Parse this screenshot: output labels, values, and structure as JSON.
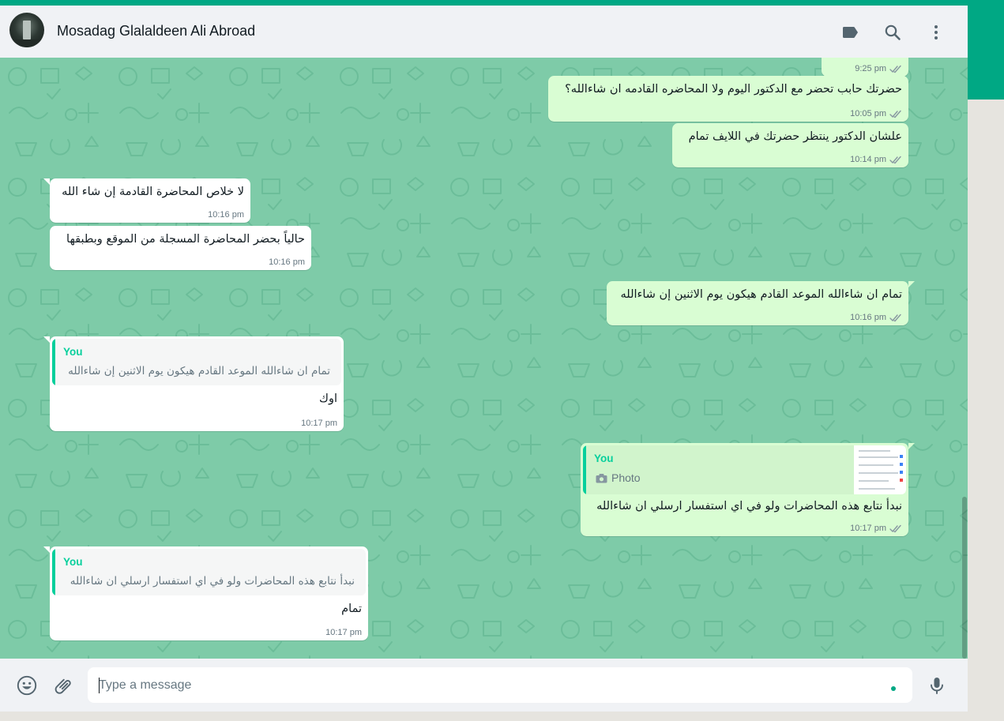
{
  "contact": {
    "name": "Mosadag Glalaldeen Ali Abroad"
  },
  "header_icons": [
    "label-icon",
    "search-icon",
    "menu-icon"
  ],
  "messages": [
    {
      "dir": "out",
      "text": "",
      "time": "9:25 pm"
    },
    {
      "dir": "out",
      "text": "حضرتك حابب تحضر مع الدكتور اليوم ولا المحاضره القادمه ان شاءالله؟",
      "time": "10:05 pm"
    },
    {
      "dir": "out",
      "text": "علشان الدكتور ينتظر حضرتك في اللايف تمام",
      "time": "10:14 pm"
    },
    {
      "dir": "in",
      "text": "لا خلاص المحاضرة القادمة إن شاء الله",
      "time": "10:16 pm"
    },
    {
      "dir": "in",
      "text": "حالياً بحضر المحاضرة المسجلة من الموقع وبطبقها",
      "time": "10:16 pm"
    },
    {
      "dir": "out",
      "text": "تمام ان شاءالله الموعد القادم هيكون يوم الاثنين إن شاءالله",
      "time": "10:16 pm"
    },
    {
      "dir": "in",
      "quote_author": "You",
      "quote_text": "تمام ان شاءالله الموعد القادم هيكون يوم الاثنين إن شاءالله",
      "text": "اوك",
      "time": "10:17 pm"
    },
    {
      "dir": "out",
      "quote_author": "You",
      "quote_text": "Photo",
      "text": "نبدأ نتابع هذه المحاضرات ولو في اي استفسار ارسلي ان شاءالله",
      "time": "10:17 pm"
    },
    {
      "dir": "in",
      "quote_author": "You",
      "quote_text": "نبدأ نتابع هذه المحاضرات ولو في اي استفسار ارسلي ان شاءالله",
      "text": "تمام",
      "time": "10:17 pm"
    }
  ],
  "composer": {
    "placeholder": "Type a message"
  },
  "footer_icons": [
    "emoji-icon",
    "attach-icon",
    "mic-icon"
  ],
  "colors": {
    "accent": "#00a884",
    "outgoing_bubble": "#d9fdd3",
    "incoming_bubble": "#ffffff",
    "chat_bg": "#7ecba8",
    "read_tick": "#8696a0",
    "quote_author": "#06cf9c"
  }
}
